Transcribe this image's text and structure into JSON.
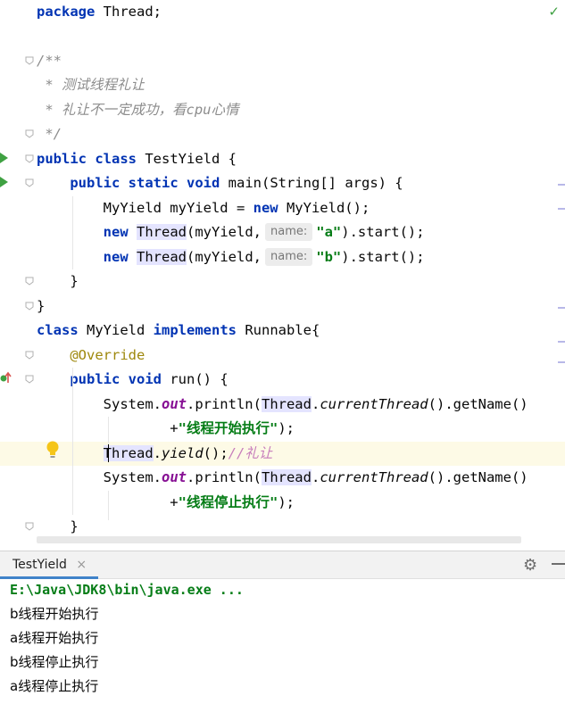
{
  "editor": {
    "lines": [
      {
        "id": "l1",
        "parts": [
          {
            "t": "package",
            "c": "kw"
          },
          {
            "t": " Thread;"
          }
        ]
      },
      {
        "id": "l2",
        "parts": []
      },
      {
        "id": "l3",
        "parts": [
          {
            "t": "/**",
            "c": "cm"
          }
        ]
      },
      {
        "id": "l4",
        "parts": [
          {
            "t": " * 测试线程礼让",
            "c": "cm"
          }
        ]
      },
      {
        "id": "l5",
        "parts": [
          {
            "t": " * 礼让不一定成功，看cpu心情",
            "c": "cm"
          }
        ]
      },
      {
        "id": "l6",
        "parts": [
          {
            "t": " */",
            "c": "cm"
          }
        ]
      },
      {
        "id": "l7",
        "parts": [
          {
            "t": "public",
            "c": "kw"
          },
          {
            "t": " "
          },
          {
            "t": "class",
            "c": "kw"
          },
          {
            "t": " TestYield {"
          }
        ]
      },
      {
        "id": "l8",
        "parts": [
          {
            "t": "    "
          },
          {
            "t": "public",
            "c": "kw"
          },
          {
            "t": " "
          },
          {
            "t": "static",
            "c": "kw"
          },
          {
            "t": " "
          },
          {
            "t": "void",
            "c": "kw"
          },
          {
            "t": " main(String[] args) {"
          }
        ]
      },
      {
        "id": "l9",
        "parts": [
          {
            "t": "        MyYield myYield = "
          },
          {
            "t": "new",
            "c": "kw"
          },
          {
            "t": " MyYield();"
          }
        ]
      },
      {
        "id": "l10",
        "parts": [
          {
            "t": "        "
          },
          {
            "t": "new",
            "c": "kw"
          },
          {
            "t": " "
          },
          {
            "t": "Thread",
            "c": "hl"
          },
          {
            "t": "(myYield,"
          },
          {
            "hint": "name:"
          },
          {
            "t": "\"a\"",
            "c": "str"
          },
          {
            "t": ").start();"
          }
        ]
      },
      {
        "id": "l11",
        "parts": [
          {
            "t": "        "
          },
          {
            "t": "new",
            "c": "kw"
          },
          {
            "t": " "
          },
          {
            "t": "Thread",
            "c": "hl"
          },
          {
            "t": "(myYield,"
          },
          {
            "hint": "name:"
          },
          {
            "t": "\"b\"",
            "c": "str"
          },
          {
            "t": ").start();"
          }
        ]
      },
      {
        "id": "l12",
        "parts": [
          {
            "t": "    }"
          }
        ]
      },
      {
        "id": "l13",
        "parts": [
          {
            "t": "}"
          }
        ]
      },
      {
        "id": "l14",
        "parts": [
          {
            "t": "class",
            "c": "kw"
          },
          {
            "t": " MyYield "
          },
          {
            "t": "implements",
            "c": "kw"
          },
          {
            "t": " Runnable{"
          }
        ]
      },
      {
        "id": "l15",
        "parts": [
          {
            "t": "    "
          },
          {
            "t": "@Override",
            "c": "ann"
          }
        ]
      },
      {
        "id": "l16",
        "parts": [
          {
            "t": "    "
          },
          {
            "t": "public",
            "c": "kw"
          },
          {
            "t": " "
          },
          {
            "t": "void",
            "c": "kw"
          },
          {
            "t": " run() {"
          }
        ]
      },
      {
        "id": "l17",
        "parts": [
          {
            "t": "        System."
          },
          {
            "t": "out",
            "c": "fld"
          },
          {
            "t": ".println("
          },
          {
            "t": "Thread",
            "c": "hl"
          },
          {
            "t": "."
          },
          {
            "t": "currentThread",
            "c": "sm"
          },
          {
            "t": "().getName()"
          }
        ]
      },
      {
        "id": "l18",
        "parts": [
          {
            "t": "                +"
          },
          {
            "t": "\"线程开始执行\"",
            "c": "str"
          },
          {
            "t": ");"
          }
        ]
      },
      {
        "id": "l19",
        "parts": [
          {
            "t": "        "
          },
          {
            "t": "Thread",
            "c": "hl"
          },
          {
            "t": "."
          },
          {
            "t": "yield",
            "c": "sm"
          },
          {
            "t": "();"
          },
          {
            "t": "//礼让",
            "c": "cmp"
          }
        ]
      },
      {
        "id": "l20",
        "parts": [
          {
            "t": "        System."
          },
          {
            "t": "out",
            "c": "fld"
          },
          {
            "t": ".println("
          },
          {
            "t": "Thread",
            "c": "hl"
          },
          {
            "t": "."
          },
          {
            "t": "currentThread",
            "c": "sm"
          },
          {
            "t": "().getName()"
          }
        ]
      },
      {
        "id": "l21",
        "parts": [
          {
            "t": "                +"
          },
          {
            "t": "\"线程停止执行\"",
            "c": "str"
          },
          {
            "t": ");"
          }
        ]
      },
      {
        "id": "l22",
        "parts": [
          {
            "t": "    }"
          }
        ]
      }
    ],
    "current_line": "l19",
    "comment_color": "#8c8c8c",
    "todo_comment_color": "#c77dbb"
  },
  "run_panel": {
    "tab_label": "TestYield",
    "close_glyph": "×",
    "gear_glyph": "⚙",
    "command": "E:\\Java\\JDK8\\bin\\java.exe ...",
    "output": [
      "b线程开始执行",
      "a线程开始执行",
      "b线程停止执行",
      "a线程停止执行"
    ]
  },
  "icons": {
    "check": "✓"
  },
  "colors": {
    "keyword": "#0033b3",
    "string": "#067d17",
    "annotation": "#9e880d",
    "field": "#871094",
    "highlight": "#e4e4ff",
    "run_arrow": "#3fa142",
    "tab_accent": "#4083c9"
  }
}
